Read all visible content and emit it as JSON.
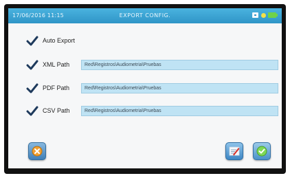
{
  "titlebar": {
    "datetime": "17/06/2016  11:15",
    "title": "EXPORT CONFIG.",
    "icons": [
      "screen-icon",
      "status-dot-icon",
      "battery-icon"
    ]
  },
  "settings": {
    "auto_export": {
      "label": "Auto Export",
      "checked": true
    },
    "xml": {
      "label": "XML Path",
      "checked": true,
      "value": "Red\\Registros\\Audiometria\\Pruebas"
    },
    "pdf": {
      "label": "PDF Path",
      "checked": true,
      "value": "Red\\Registros\\Audiometria\\Pruebas"
    },
    "csv": {
      "label": "CSV Path",
      "checked": true,
      "value": "Red\\Registros\\Audiometria\\Pruebas"
    }
  },
  "buttons": {
    "cancel_icon": "cancel-icon",
    "edit_icon": "edit-icon",
    "confirm_icon": "checkmark-icon"
  },
  "colors": {
    "titlebar": "#2f95c7",
    "path_field": "#bfe3f4",
    "checkmark": "#1e3a5c"
  }
}
